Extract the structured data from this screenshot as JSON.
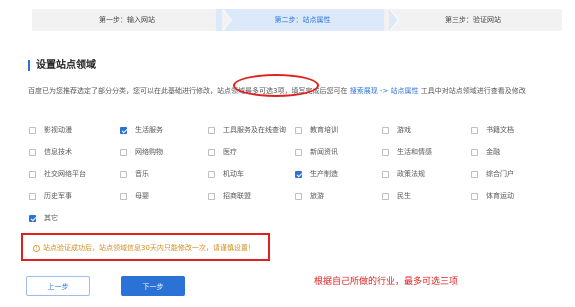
{
  "steps": [
    {
      "label": "第一步：输入网站",
      "state": "done"
    },
    {
      "label": "第二步：站点属性",
      "state": "active"
    },
    {
      "label": "第三步：验证网站",
      "state": "pending"
    }
  ],
  "section_title": "设置站点领域",
  "description": {
    "part1": "百度已为您推荐选定了部分分类，您可以在此基础进行修改，",
    "limit": "站点领域最多可选3项",
    "part2": "，填写完成后您可在 ",
    "link": "搜索展现 -> 站点属性",
    "part3": " 工具中对站点领域进行查看及修改"
  },
  "categories": [
    {
      "label": "影视动漫",
      "checked": false
    },
    {
      "label": "生活服务",
      "checked": true
    },
    {
      "label": "工具服务及在线查询",
      "checked": false
    },
    {
      "label": "教育培训",
      "checked": false
    },
    {
      "label": "游戏",
      "checked": false
    },
    {
      "label": "书籍文档",
      "checked": false
    },
    {
      "label": "信息技术",
      "checked": false
    },
    {
      "label": "网络购物",
      "checked": false
    },
    {
      "label": "医疗",
      "checked": false
    },
    {
      "label": "新闻资讯",
      "checked": false
    },
    {
      "label": "生活和情感",
      "checked": false
    },
    {
      "label": "金融",
      "checked": false
    },
    {
      "label": "社交网络平台",
      "checked": false
    },
    {
      "label": "音乐",
      "checked": false
    },
    {
      "label": "机动车",
      "checked": false
    },
    {
      "label": "生产制造",
      "checked": true
    },
    {
      "label": "政策法规",
      "checked": false
    },
    {
      "label": "综合门户",
      "checked": false
    },
    {
      "label": "历史军事",
      "checked": false
    },
    {
      "label": "母婴",
      "checked": false
    },
    {
      "label": "招商联盟",
      "checked": false
    },
    {
      "label": "旅游",
      "checked": false
    },
    {
      "label": "民生",
      "checked": false
    },
    {
      "label": "体育运动",
      "checked": false
    },
    {
      "label": "其它",
      "checked": true
    }
  ],
  "notice": {
    "icon": "info-icon",
    "text": "站点验证成功后，站点领域信息30天内只能修改一次，请谨慎设置！"
  },
  "annotation": "根据自己所做的行业，最多可选三项",
  "buttons": {
    "prev": "上一步",
    "next": "下一步"
  },
  "colors": {
    "accent": "#2b72d6",
    "highlight_red": "#e02020",
    "notice_orange": "#d48a1a"
  }
}
